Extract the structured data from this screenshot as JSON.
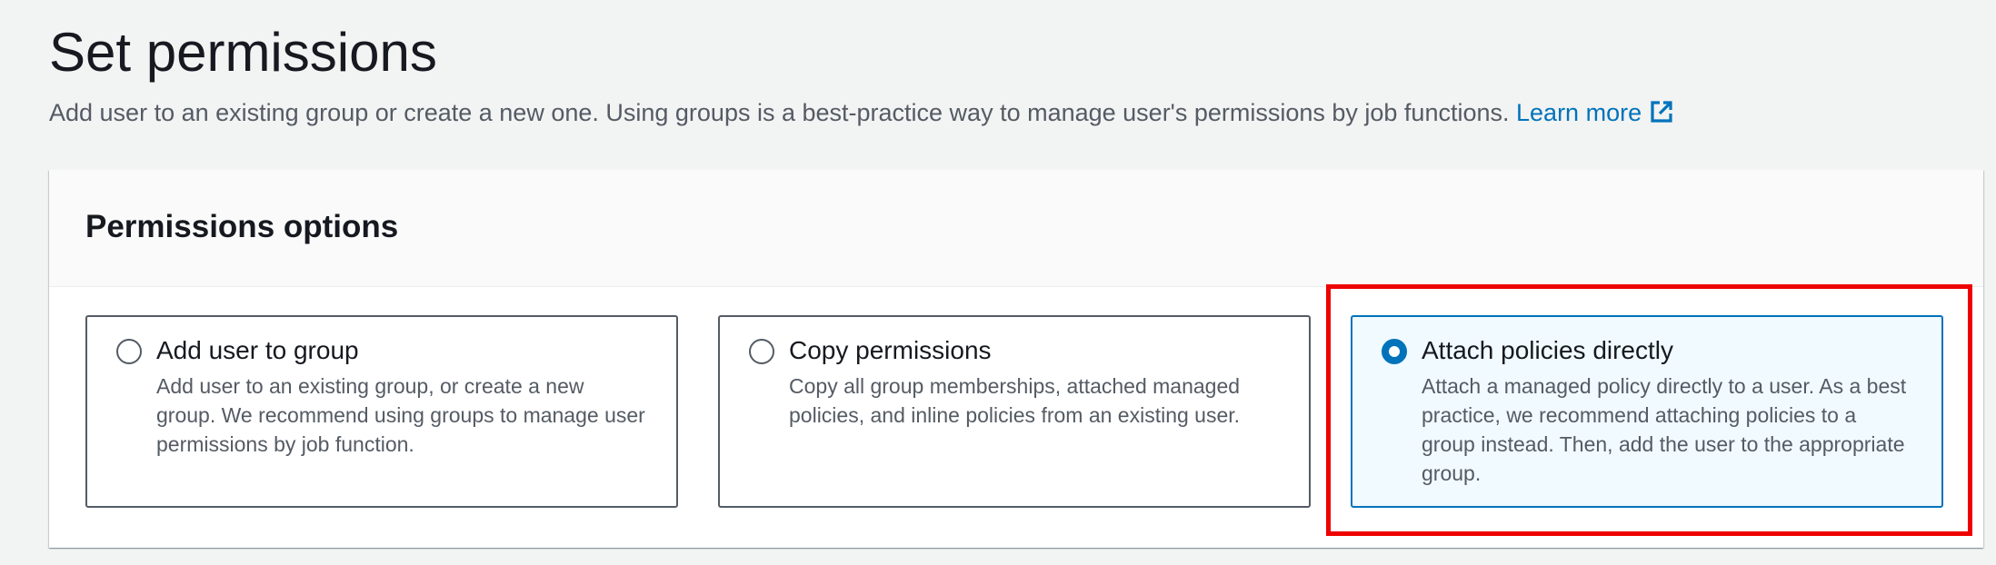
{
  "header": {
    "title": "Set permissions",
    "description": "Add user to an existing group or create a new one. Using groups is a best-practice way to manage user's permissions by job functions.",
    "learn_more": "Learn more"
  },
  "permissions_panel": {
    "title": "Permissions options",
    "selected_option": "Attach policies directly",
    "options": [
      {
        "label": "Add user to group",
        "description": "Add user to an existing group, or create a new group. We recommend using groups to manage user permissions by job function.",
        "selected": false
      },
      {
        "label": "Copy permissions",
        "description": "Copy all group memberships, attached managed policies, and inline policies from an existing user.",
        "selected": false
      },
      {
        "label": "Attach policies directly",
        "description": "Attach a managed policy directly to a user. As a best practice, we recommend attaching policies to a group instead. Then, add the user to the appropriate group.",
        "selected": true
      }
    ]
  },
  "annotation": {
    "highlight_color": "#ee0000",
    "highlighted_option": "Attach policies directly"
  },
  "colors": {
    "accent": "#0073bb",
    "selected_tile_bg": "#f1faff",
    "page_bg": "#f2f3f3"
  },
  "icons": {
    "external_link": "external-link-icon"
  }
}
